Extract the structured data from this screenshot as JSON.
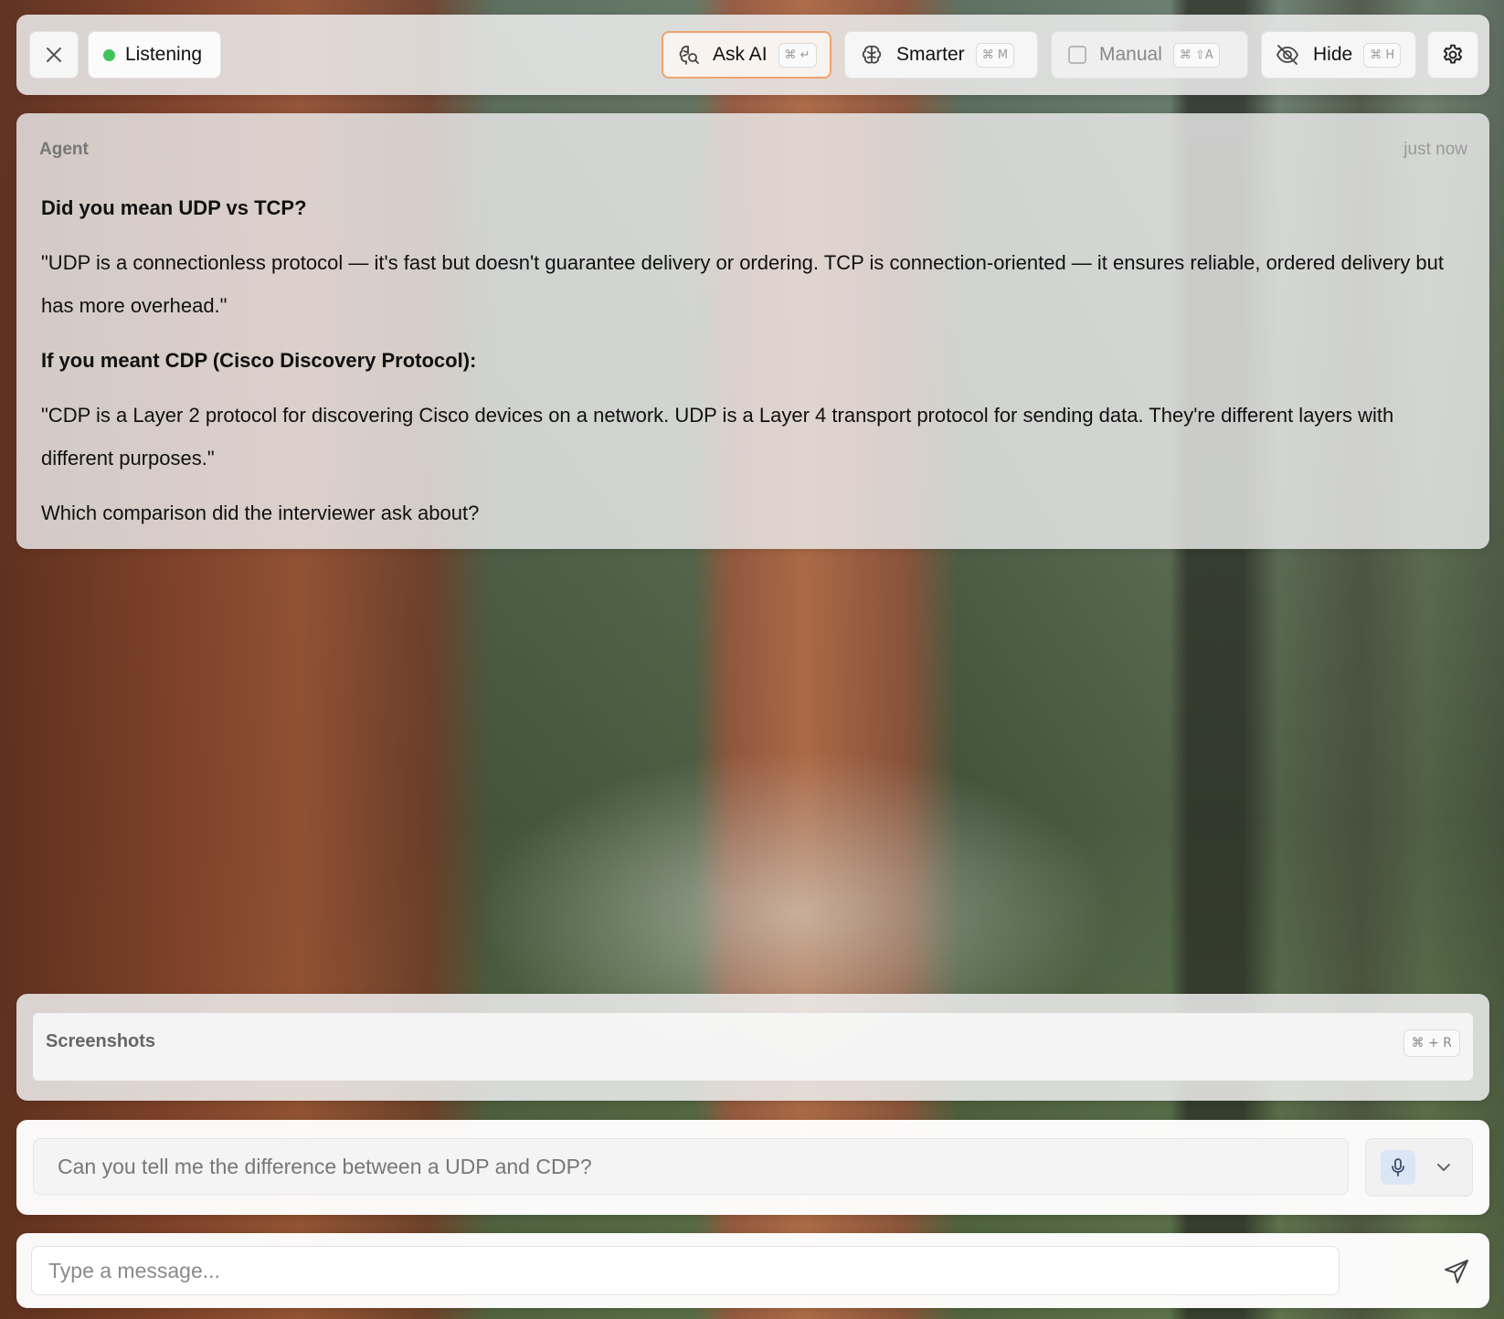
{
  "toolbar": {
    "listening_label": "Listening",
    "ask_ai": {
      "label": "Ask AI",
      "shortcut": "⌘ ↵"
    },
    "smarter": {
      "label": "Smarter",
      "shortcut": "⌘ M"
    },
    "manual": {
      "label": "Manual",
      "shortcut": "⌘ ⇧A"
    },
    "hide": {
      "label": "Hide",
      "shortcut": "⌘ H"
    },
    "status_color": "#3fc45d",
    "accent_color": "#f0a36b"
  },
  "agent": {
    "sender": "Agent",
    "time": "just now",
    "heading1": "Did you mean UDP vs TCP?",
    "para1": "\"UDP is a connectionless protocol — it's fast but doesn't guarantee delivery or ordering. TCP is connection-oriented — it ensures reliable, ordered delivery but has more overhead.\"",
    "heading2": "If you meant CDP (Cisco Discovery Protocol):",
    "para2": "\"CDP is a Layer 2 protocol for discovering Cisco devices on a network. UDP is a Layer 4 transport protocol for sending data. They're different layers with different purposes.\"",
    "question": "Which comparison did the interviewer ask about?"
  },
  "screenshots": {
    "label": "Screenshots",
    "shortcut": "⌘ + R"
  },
  "transcript": {
    "text": "Can you tell me the difference between a UDP and CDP?"
  },
  "message": {
    "placeholder": "Type a message..."
  },
  "icons": {
    "close": "close-icon",
    "ask_ai": "brain-search-icon",
    "smarter": "brain-icon",
    "manual": "checkbox-icon",
    "hide": "eye-off-icon",
    "settings": "gear-icon",
    "mic": "microphone-icon",
    "dropdown": "chevron-down-icon",
    "send": "send-icon"
  }
}
